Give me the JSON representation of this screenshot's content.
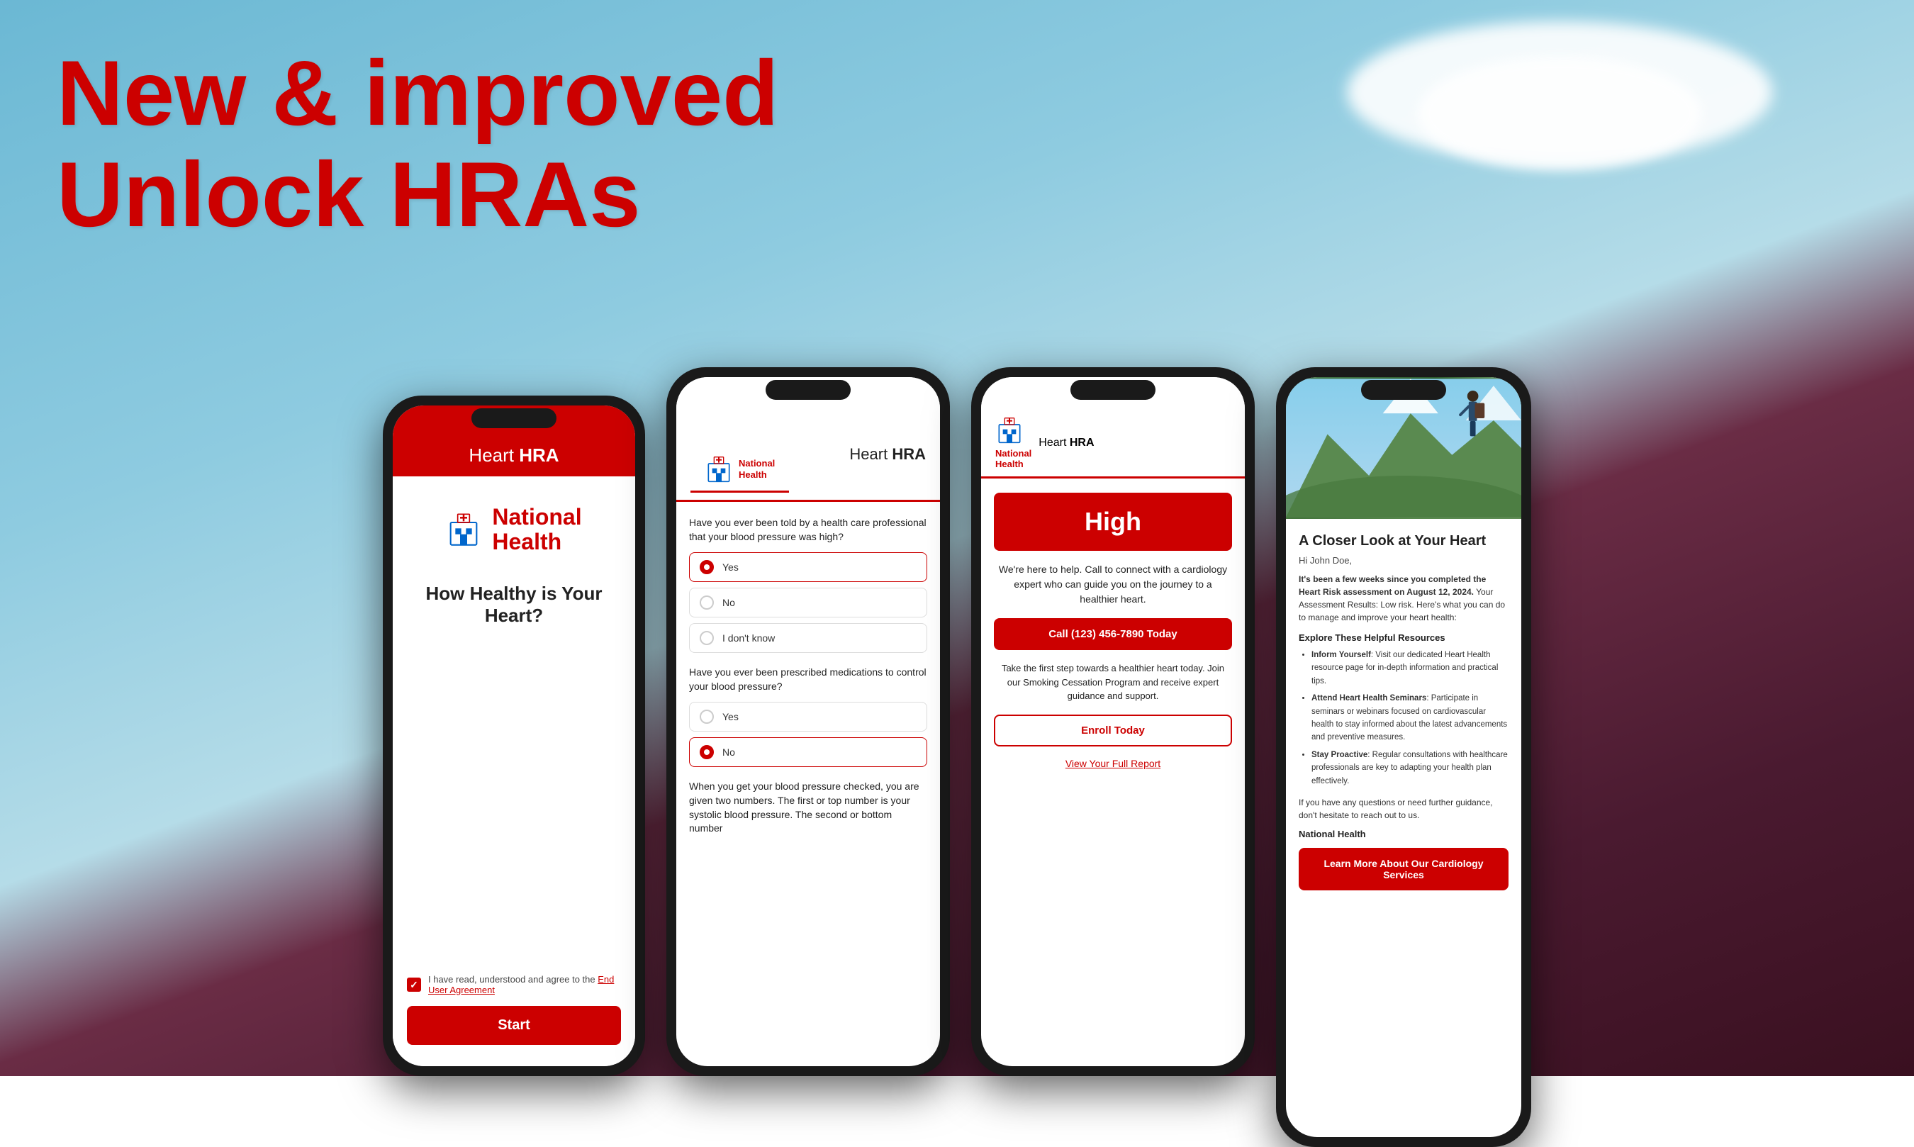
{
  "background": {
    "sky_color": "#7bbfd4",
    "ground_color": "#4a1a30"
  },
  "headline": {
    "line1": "New & improved",
    "line2": "Unlock HRAs"
  },
  "phone1": {
    "header_title": "Heart ",
    "header_title_bold": "HRA",
    "org_name_line1": "National",
    "org_name_line2": "Health",
    "tagline": "How Healthy is Your Heart?",
    "checkbox_label": "I have read, understood and agree to the ",
    "checkbox_link": "End User Agreement",
    "start_button": "Start"
  },
  "phone2": {
    "header_org_line1": "National",
    "header_org_line2": "Health",
    "header_app": "Heart HRA",
    "question1": "Have you ever been told by a health care professional that your blood pressure was high?",
    "q1_options": [
      "Yes",
      "No",
      "I don't know"
    ],
    "q1_selected": "Yes",
    "question2": "Have you ever been prescribed medications to control your blood pressure?",
    "q2_options": [
      "Yes",
      "No"
    ],
    "q2_selected": "No",
    "question3_partial": "When you get your blood pressure checked, you are given two numbers. The first or top number is your systolic blood pressure. The second or bottom number"
  },
  "phone3": {
    "header_org_line1": "National",
    "header_org_line2": "Health",
    "header_app": "Heart HRA",
    "risk_level": "High",
    "help_intro": "We're here to help. Call to connect with a cardiology expert who can guide you on the journey to a healthier heart.",
    "call_button": "Call (123) 456-7890 Today",
    "step_text": "Take the first step towards a healthier heart today. Join our Smoking Cessation Program and receive expert guidance and support.",
    "enroll_button": "Enroll Today",
    "view_report_link": "View Your Full Report"
  },
  "phone4": {
    "article_title": "A Closer Look at Your Heart",
    "greeting": "Hi John Doe,",
    "intro_bold": "It's been a few weeks since you completed the Heart Risk assessment on August 12, 2024.",
    "intro_rest": " Your Assessment Results:  Low risk. Here's what you can do to manage and improve your heart health:",
    "section_title": "Explore These Helpful Resources",
    "resources": [
      {
        "title": "Inform Yourself",
        "description": ": Visit our dedicated Heart Health resource page for in-depth information and practical tips."
      },
      {
        "title": "Attend Heart Health Seminars",
        "description": ": Participate in seminars or webinars focused on cardiovascular health to stay informed about the latest advancements and preventive measures."
      },
      {
        "title": "Stay Proactive",
        "description": ": Regular consultations with healthcare professionals are key to adapting your health plan effectively."
      }
    ],
    "contact_text": "If you have any questions or need further guidance, don't hesitate to reach out to us.",
    "org_name": "National Health",
    "cta_button": "Learn More About Our Cardiology Services"
  }
}
